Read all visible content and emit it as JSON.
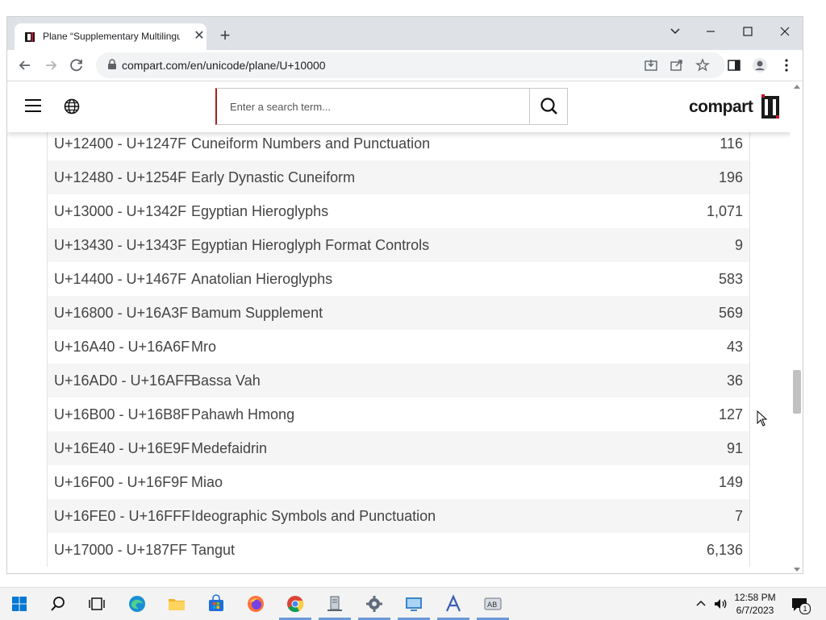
{
  "browser": {
    "tab_title": "Plane “Supplementary Multilingual",
    "url_host": "compart.com",
    "url_path": "/en/unicode/plane/U+10000"
  },
  "site": {
    "search_placeholder": "Enter a search term...",
    "logo_text": "compart"
  },
  "blocks": [
    {
      "range": "U+12400 - U+1247F",
      "name": "Cuneiform Numbers and Punctuation",
      "count": "116"
    },
    {
      "range": "U+12480 - U+1254F",
      "name": "Early Dynastic Cuneiform",
      "count": "196"
    },
    {
      "range": "U+13000 - U+1342F",
      "name": "Egyptian Hieroglyphs",
      "count": "1,071"
    },
    {
      "range": "U+13430 - U+1343F",
      "name": "Egyptian Hieroglyph Format Controls",
      "count": "9"
    },
    {
      "range": "U+14400 - U+1467F",
      "name": "Anatolian Hieroglyphs",
      "count": "583"
    },
    {
      "range": "U+16800 - U+16A3F",
      "name": "Bamum Supplement",
      "count": "569"
    },
    {
      "range": "U+16A40 - U+16A6F",
      "name": "Mro",
      "count": "43"
    },
    {
      "range": "U+16AD0 - U+16AFF",
      "name": "Bassa Vah",
      "count": "36"
    },
    {
      "range": "U+16B00 - U+16B8F",
      "name": "Pahawh Hmong",
      "count": "127"
    },
    {
      "range": "U+16E40 - U+16E9F",
      "name": "Medefaidrin",
      "count": "91"
    },
    {
      "range": "U+16F00 - U+16F9F",
      "name": "Miao",
      "count": "149"
    },
    {
      "range": "U+16FE0 - U+16FFF",
      "name": "Ideographic Symbols and Punctuation",
      "count": "7"
    },
    {
      "range": "U+17000 - U+187FF",
      "name": "Tangut",
      "count": "6,136"
    }
  ],
  "taskbar": {
    "time": "12:58 PM",
    "date": "6/7/2023",
    "notification_count": "1"
  }
}
